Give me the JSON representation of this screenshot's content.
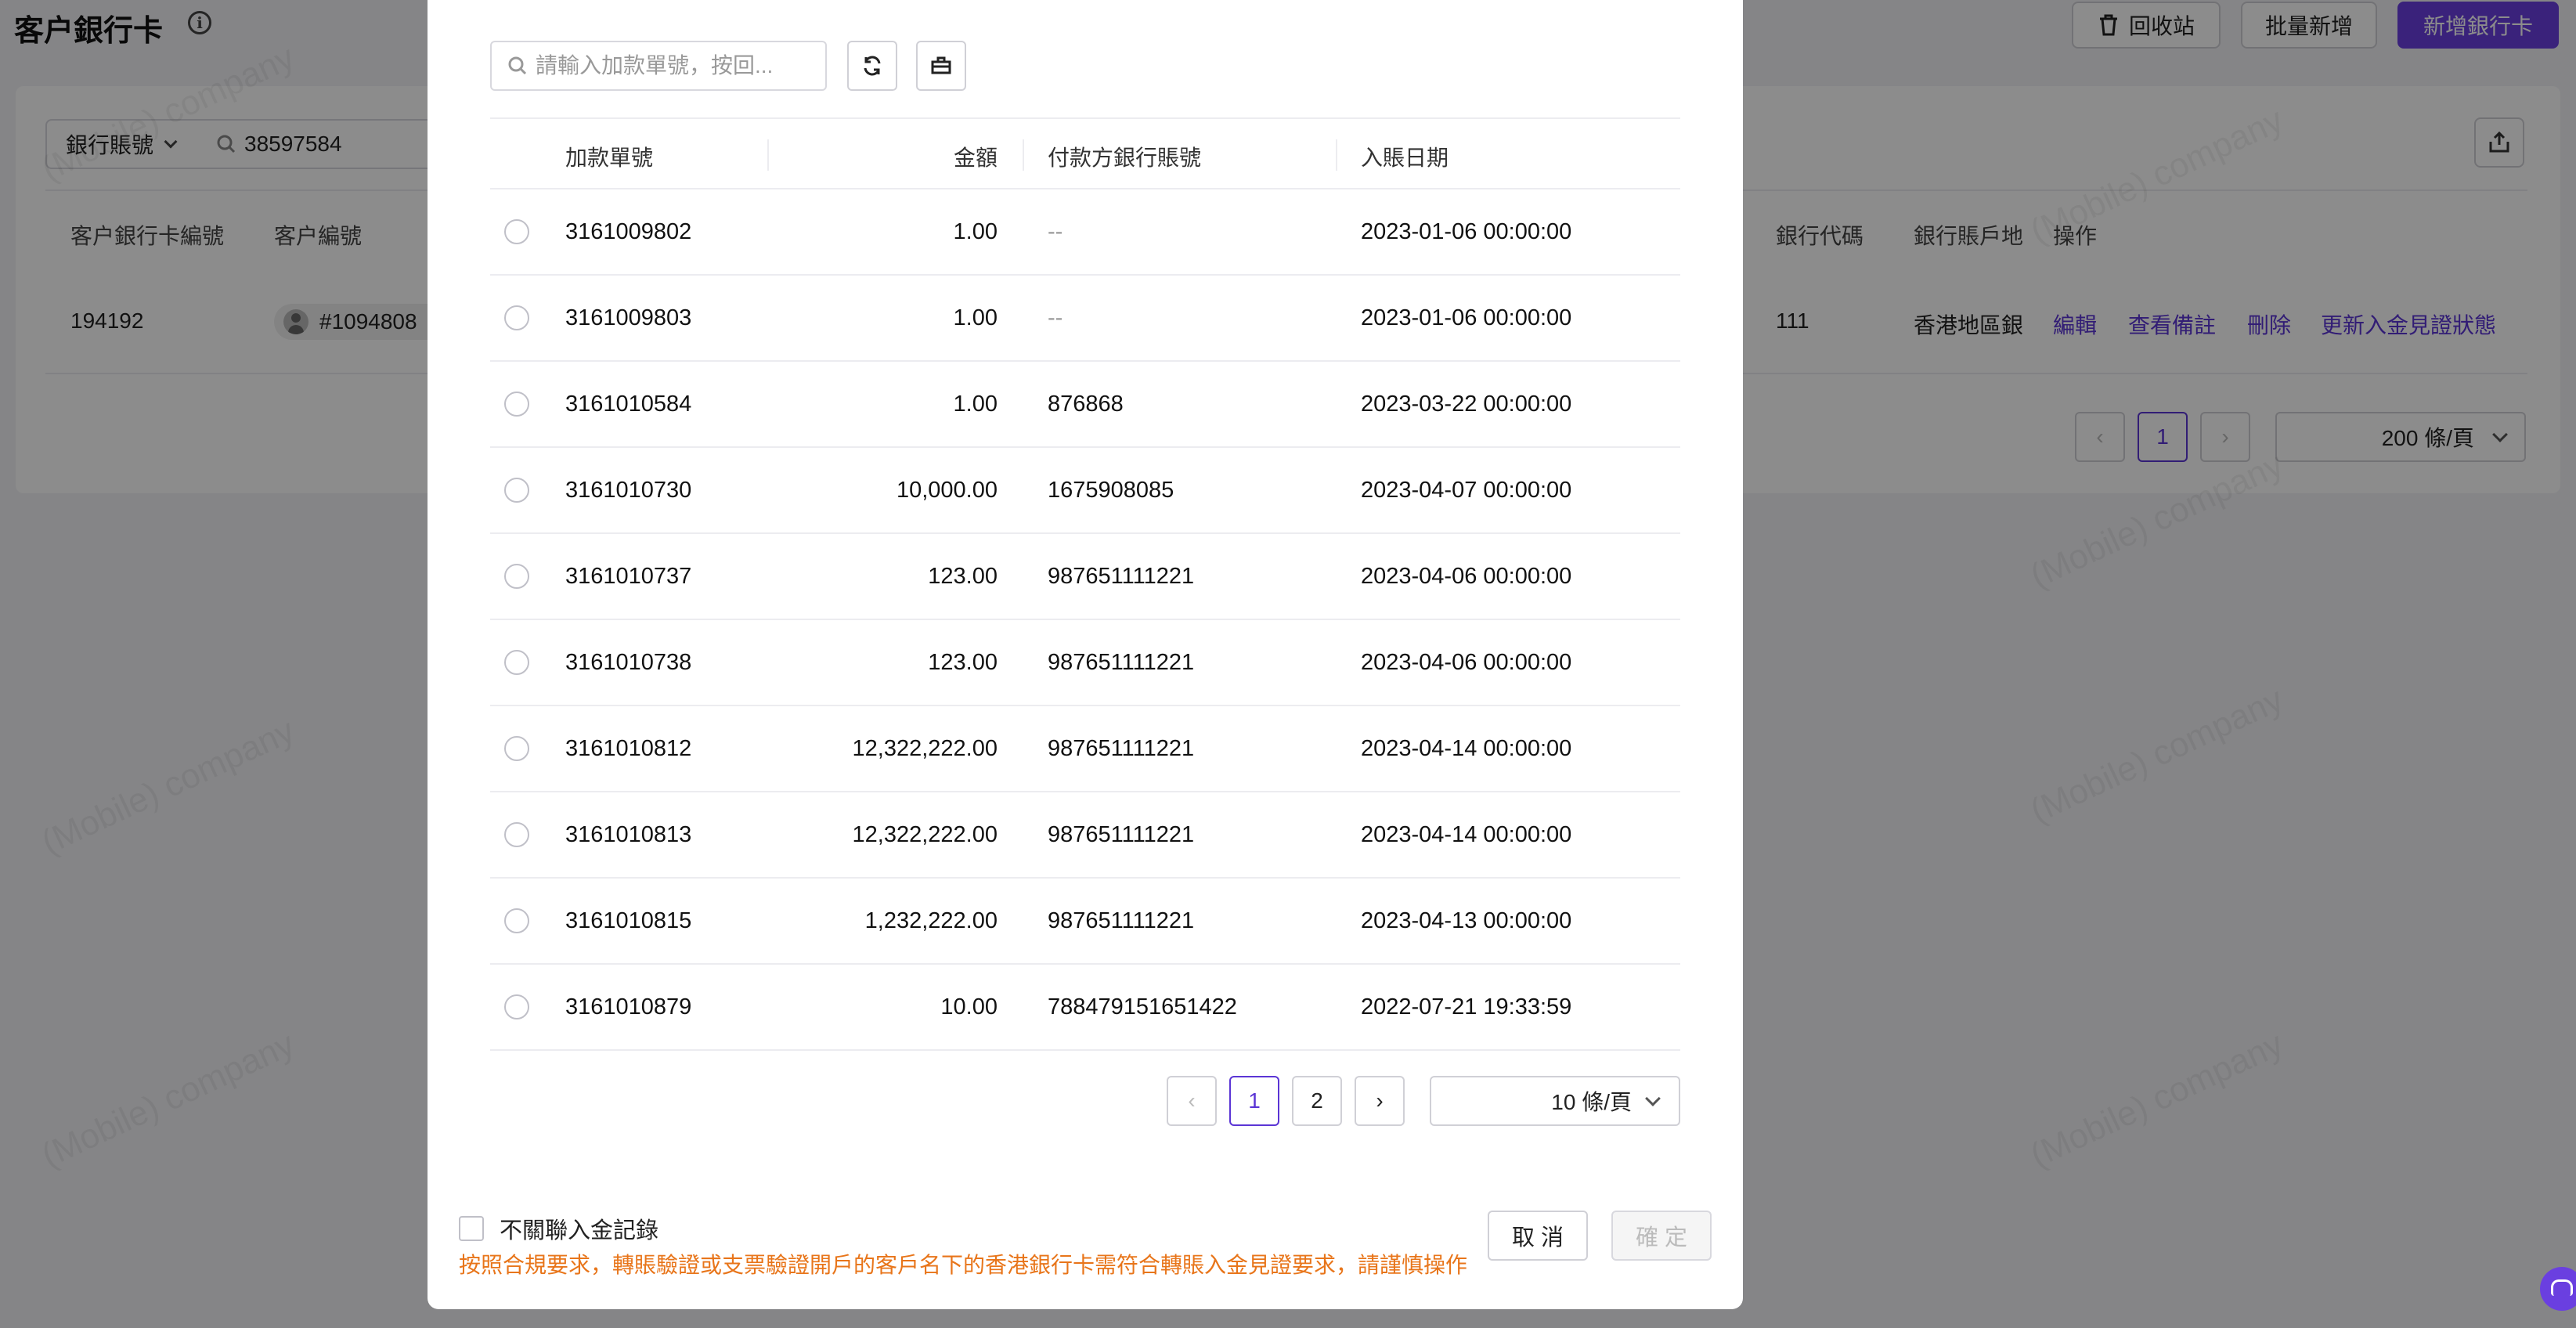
{
  "page": {
    "title": "客户銀行卡",
    "top_buttons": {
      "recycle": "回收站",
      "batch_add": "批量新增",
      "add_card": "新增銀行卡"
    },
    "filter": {
      "field": "銀行賬號",
      "value": "38597584"
    },
    "table_headers": [
      "客户銀行卡編號",
      "客户編號",
      "銀行代碼",
      "銀行賬戶地",
      "操作"
    ],
    "row": {
      "card_no": "194192",
      "customer_no": "#1094808",
      "bank_code": "111",
      "region": "香港地區銀"
    },
    "actions": {
      "edit": "編輯",
      "view_notes": "查看備註",
      "delete": "刪除",
      "update_status": "更新入金見證狀態"
    },
    "pagination": {
      "current": "1",
      "page_size": "200 條/頁"
    },
    "watermark": "(Mobile) company"
  },
  "modal": {
    "search_placeholder": "請輸入加款單號，按回...",
    "columns": {
      "order_no": "加款單號",
      "amount": "金額",
      "payer_account": "付款方銀行賬號",
      "date": "入賬日期"
    },
    "rows": [
      {
        "order_no": "3161009802",
        "amount": "1.00",
        "payer_account": "--",
        "date": "2023-01-06 00:00:00"
      },
      {
        "order_no": "3161009803",
        "amount": "1.00",
        "payer_account": "--",
        "date": "2023-01-06 00:00:00"
      },
      {
        "order_no": "3161010584",
        "amount": "1.00",
        "payer_account": "876868",
        "date": "2023-03-22 00:00:00"
      },
      {
        "order_no": "3161010730",
        "amount": "10,000.00",
        "payer_account": "1675908085",
        "date": "2023-04-07 00:00:00"
      },
      {
        "order_no": "3161010737",
        "amount": "123.00",
        "payer_account": "987651111221",
        "date": "2023-04-06 00:00:00"
      },
      {
        "order_no": "3161010738",
        "amount": "123.00",
        "payer_account": "987651111221",
        "date": "2023-04-06 00:00:00"
      },
      {
        "order_no": "3161010812",
        "amount": "12,322,222.00",
        "payer_account": "987651111221",
        "date": "2023-04-14 00:00:00"
      },
      {
        "order_no": "3161010813",
        "amount": "12,322,222.00",
        "payer_account": "987651111221",
        "date": "2023-04-14 00:00:00"
      },
      {
        "order_no": "3161010815",
        "amount": "1,232,222.00",
        "payer_account": "987651111221",
        "date": "2023-04-13 00:00:00"
      },
      {
        "order_no": "3161010879",
        "amount": "10.00",
        "payer_account": "788479151651422",
        "date": "2022-07-21 19:33:59"
      }
    ],
    "pagination": {
      "pages": [
        "1",
        "2"
      ],
      "current": "1",
      "page_size": "10 條/頁"
    },
    "footer": {
      "checkbox_label": "不關聯入金記錄",
      "warning": "按照合規要求，轉賬驗證或支票驗證開戶的客戶名下的香港銀行卡需符合轉賬入金見證要求，請謹慎操作",
      "cancel": "取 消",
      "confirm": "確 定"
    }
  },
  "colors": {
    "primary": "#6a3fe0",
    "link": "#5b35d5",
    "warning": "#e8751a"
  }
}
